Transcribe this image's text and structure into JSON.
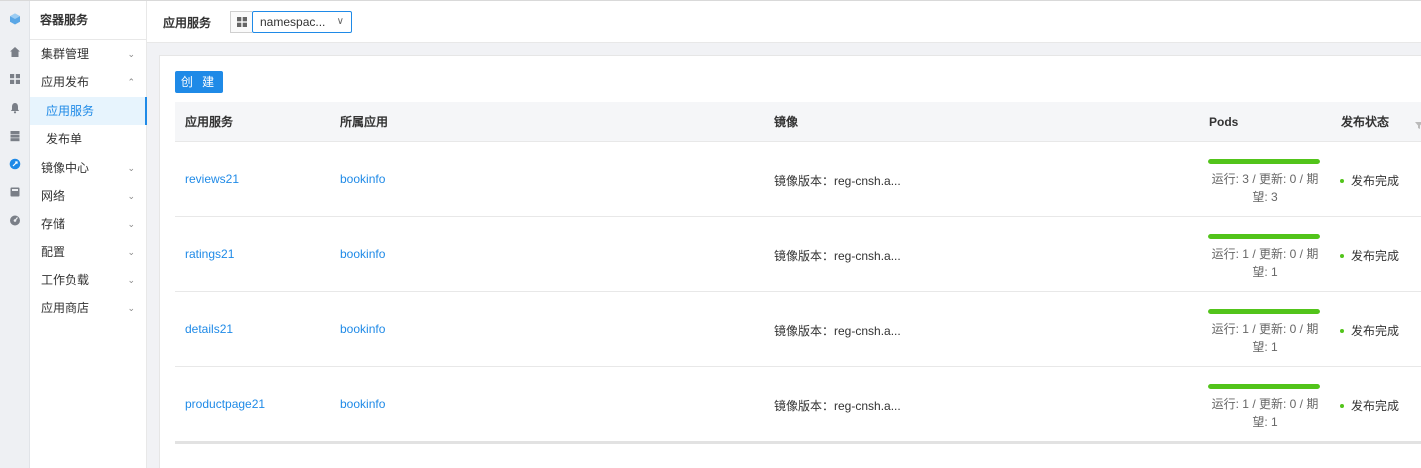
{
  "colors": {
    "accent": "#1f8ae7",
    "success": "#52c41a",
    "rail_bg": "#eef0f3"
  },
  "rail": {
    "icons": [
      "cube-logo-icon",
      "home-icon",
      "grid-icon",
      "bell-icon",
      "server-icon",
      "rocket-icon",
      "storage-icon",
      "dashboard-icon"
    ]
  },
  "nav": {
    "title": "容器服务",
    "items": [
      {
        "label": "集群管理",
        "chevron": "⌄"
      },
      {
        "label": "应用发布",
        "chevron": "⌃"
      },
      {
        "label": "应用服务"
      },
      {
        "label": "发布单"
      },
      {
        "label": "镜像中心",
        "chevron": "⌄"
      },
      {
        "label": "网络",
        "chevron": "⌄"
      },
      {
        "label": "存储",
        "chevron": "⌄"
      },
      {
        "label": "配置",
        "chevron": "⌄"
      },
      {
        "label": "工作负载",
        "chevron": "⌄"
      },
      {
        "label": "应用商店",
        "chevron": "⌄"
      }
    ]
  },
  "header": {
    "title": "应用服务",
    "namespace_value": "namespac...",
    "namespace_chevron": "∨"
  },
  "toolbar": {
    "create_label": "创 建"
  },
  "table": {
    "columns": [
      "应用服务",
      "所属应用",
      "镜像",
      "Pods",
      "发布状态"
    ],
    "rows": [
      {
        "name": "reviews21",
        "app": "bookinfo",
        "image": "镜像版本：reg-cnsh.a...",
        "pods_ratio": 1.0,
        "pods": "运行: 3 / 更新: 0 / 期望: 3",
        "status": "发布完成"
      },
      {
        "name": "ratings21",
        "app": "bookinfo",
        "image": "镜像版本：reg-cnsh.a...",
        "pods_ratio": 1.0,
        "pods": "运行: 1 / 更新: 0 / 期望: 1",
        "status": "发布完成"
      },
      {
        "name": "details21",
        "app": "bookinfo",
        "image": "镜像版本：reg-cnsh.a...",
        "pods_ratio": 1.0,
        "pods": "运行: 1 / 更新: 0 / 期望: 1",
        "status": "发布完成"
      },
      {
        "name": "productpage21",
        "app": "bookinfo",
        "image": "镜像版本：reg-cnsh.a...",
        "pods_ratio": 1.0,
        "pods": "运行: 1 / 更新: 0 / 期望: 1",
        "status": "发布完成"
      }
    ]
  }
}
